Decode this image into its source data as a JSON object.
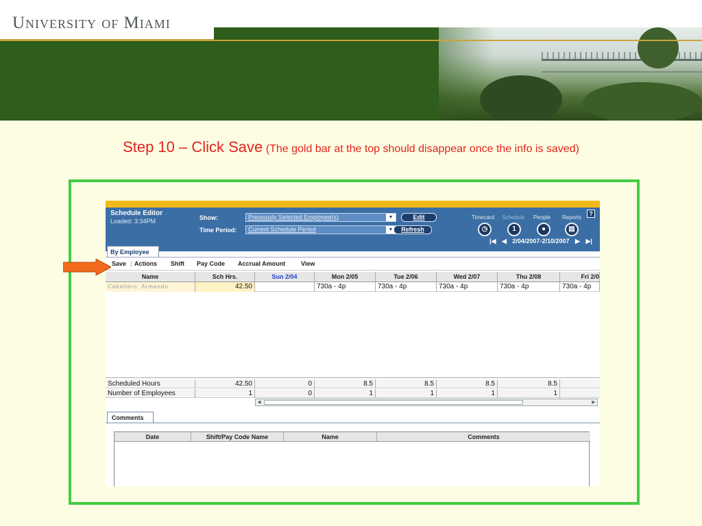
{
  "banner": {
    "university": "University of Miami"
  },
  "step": {
    "main": "Step 10 – Click Save",
    "note": "(The gold bar at the top should disappear once the info is saved)"
  },
  "app": {
    "title": "Schedule Editor",
    "loaded": "Loaded: 3:34PM",
    "show_label": "Show:",
    "show_value": "Previously Selected Employee(s)",
    "period_label": "Time Period:",
    "period_value": "Current Schedule Period",
    "edit_label": "Edit",
    "refresh_label": "Refresh",
    "nav": {
      "timecard": "Timecard",
      "schedule": "Schedule",
      "people": "People",
      "reports": "Reports"
    },
    "help": "?",
    "date_range": "2/04/2007-2/10/2007",
    "tab_by_employee": "By Employee",
    "menu": [
      "Save",
      "Actions",
      "Shift",
      "Pay Code",
      "Accrual Amount",
      "View"
    ],
    "columns": [
      "Name",
      "Sch Hrs.",
      "Sun 2/04",
      "Mon 2/05",
      "Tue 2/06",
      "Wed 2/07",
      "Thu 2/08",
      "Fri 2/0"
    ],
    "row1": {
      "name": "Caballero, Armando",
      "sch_hrs": "42.50",
      "sun": "",
      "mon": "730a - 4p",
      "tue": "730a - 4p",
      "wed": "730a - 4p",
      "thu": "730a - 4p",
      "fri": "730a - 4p"
    },
    "totals": [
      {
        "label": "Scheduled Hours",
        "sch": "42.50",
        "sun": "0",
        "mon": "8.5",
        "tue": "8.5",
        "wed": "8.5",
        "thu": "8.5"
      },
      {
        "label": "Number of Employees",
        "sch": "1",
        "sun": "0",
        "mon": "1",
        "tue": "1",
        "wed": "1",
        "thu": "1"
      }
    ],
    "comments_tab": "Comments",
    "comments_columns": [
      "Date",
      "Shift/Pay Code Name",
      "Name",
      "Comments"
    ]
  },
  "colors": {
    "accent_red": "#e2241b",
    "frame_green": "#44cc44",
    "app_blue": "#3b6ea5",
    "gold_bar": "#f2b81a",
    "arrow_orange": "#f26a1b"
  }
}
